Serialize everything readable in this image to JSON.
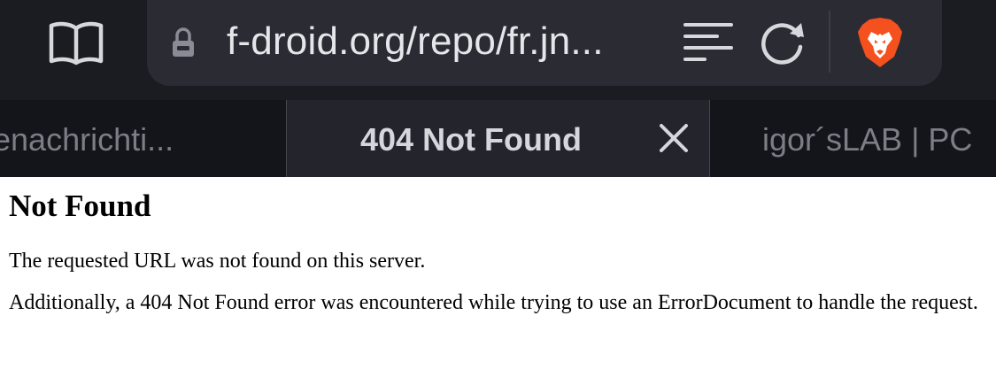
{
  "browser": {
    "url": "f-droid.org/repo/fr.jn...",
    "icons": {
      "bookmarks": "book-open-icon",
      "lock": "lock-icon",
      "reader": "reader-mode-icon",
      "reload": "reload-icon",
      "brand": "brave-lion-icon",
      "close": "close-icon"
    },
    "colors": {
      "topbar": "#1b1c22",
      "urlbar": "#2a2b33",
      "brave_orange": "#f4511e"
    }
  },
  "tabs": [
    {
      "title": "enachrichti...",
      "active": false
    },
    {
      "title": "404 Not Found",
      "active": true
    },
    {
      "title": "igor´sLAB | PC",
      "active": false
    }
  ],
  "page": {
    "heading": "Not Found",
    "paragraph1": "The requested URL was not found on this server.",
    "paragraph2": "Additionally, a 404 Not Found error was encountered while trying to use an ErrorDocument to handle the request."
  }
}
